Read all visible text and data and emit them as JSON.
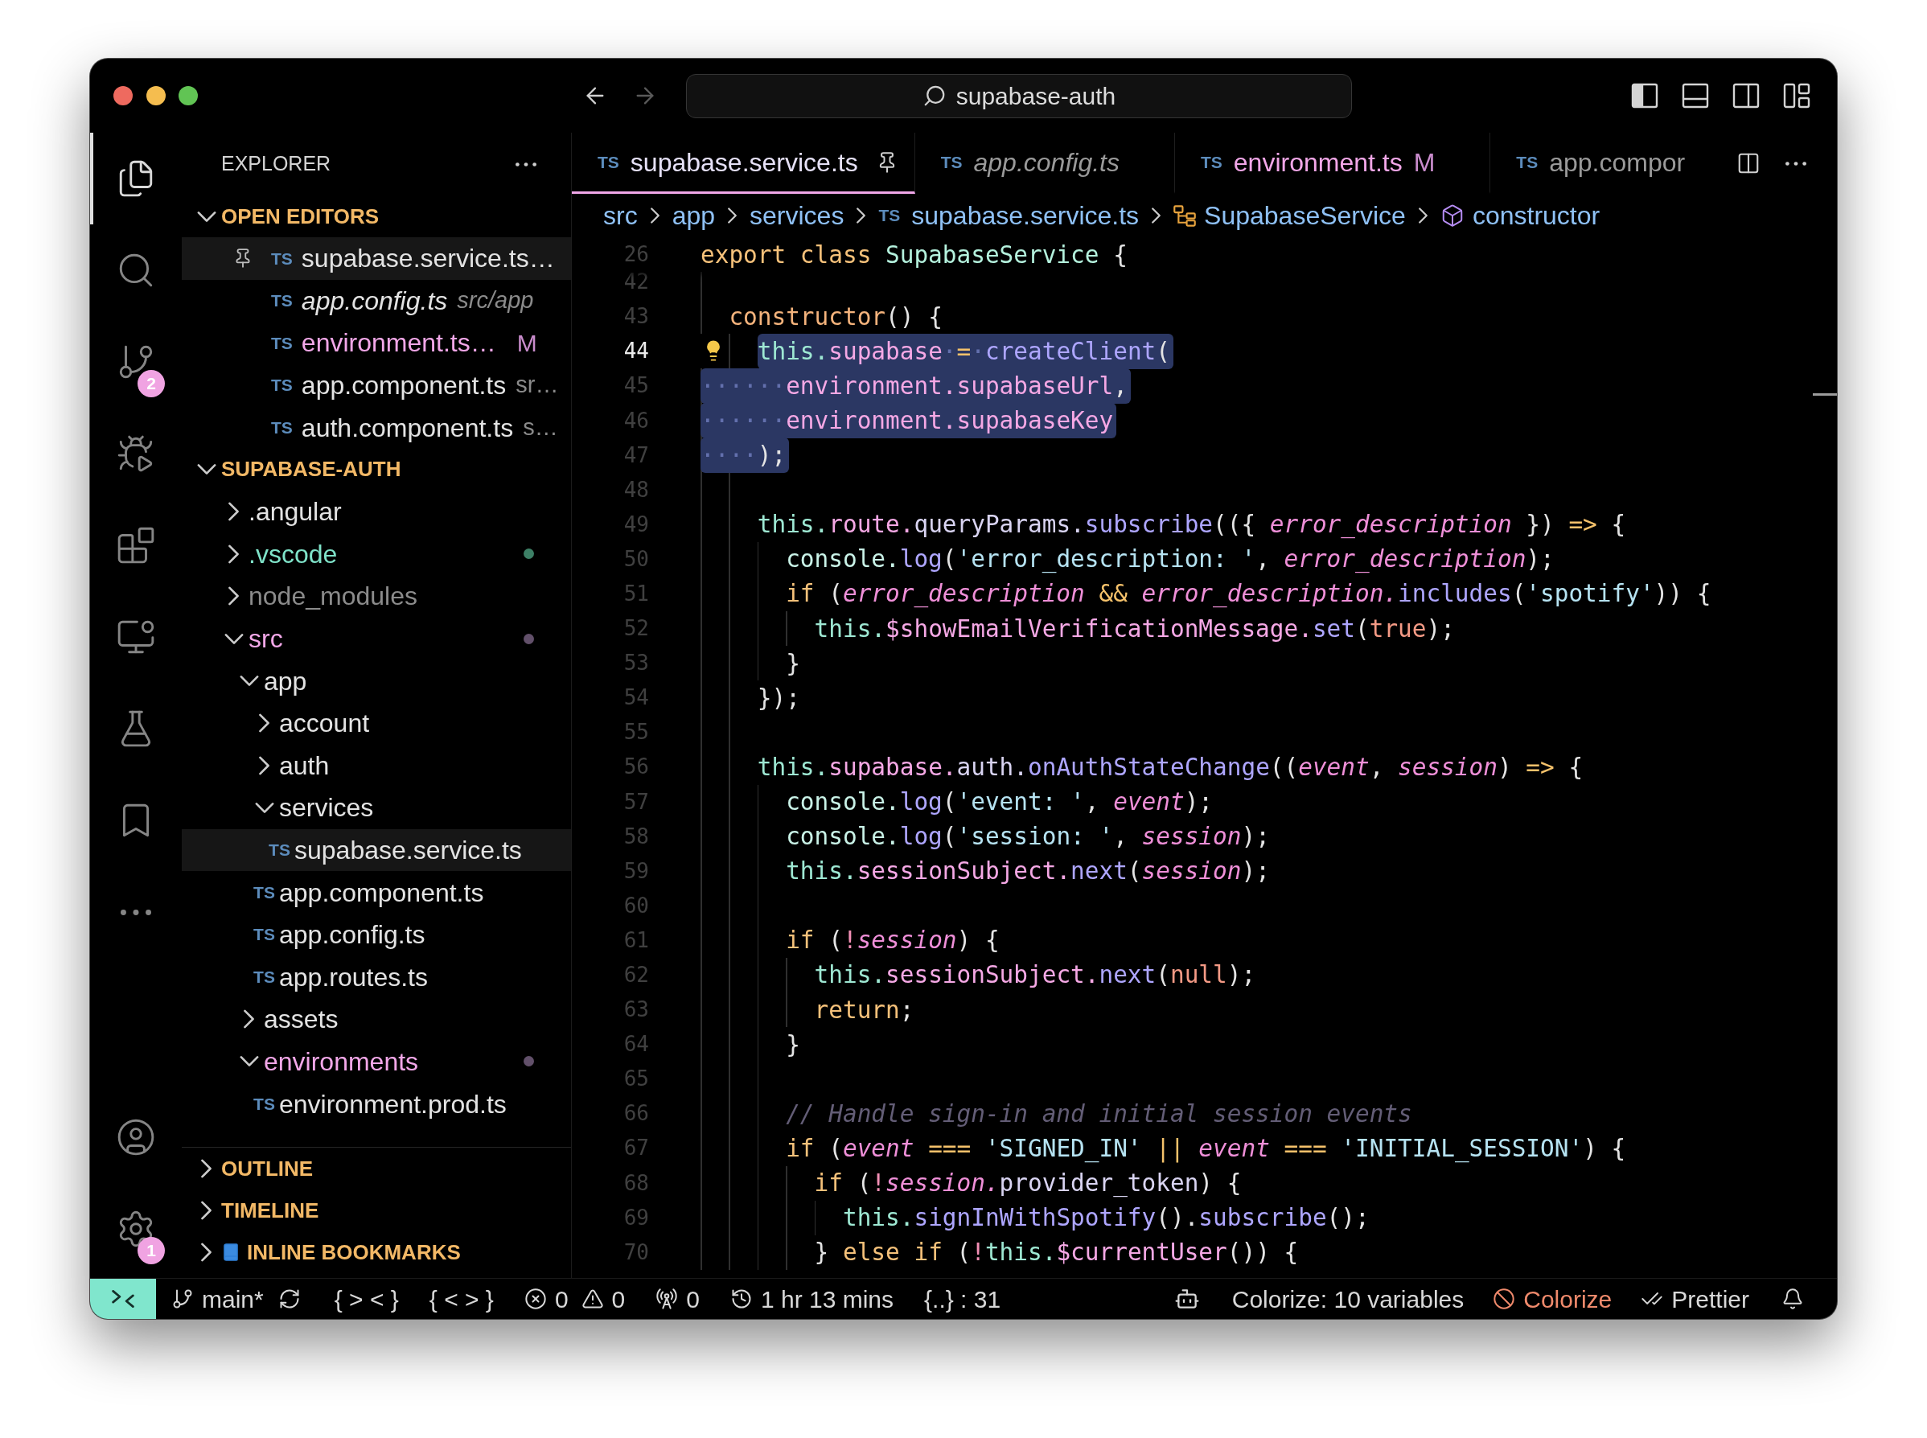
{
  "title_bar": {
    "navigation": [
      {
        "kind": "back",
        "disabled": false
      },
      {
        "kind": "forward",
        "disabled": true
      }
    ],
    "search_text": "supabase-auth",
    "layout_buttons": [
      {
        "kind": "primary-sidebar",
        "on": true
      },
      {
        "kind": "panel",
        "on": false
      },
      {
        "kind": "secondary-sidebar",
        "on": false
      },
      {
        "kind": "customize-layout"
      }
    ]
  },
  "activity_bar": {
    "top": [
      {
        "kind": "explorer",
        "selected": true
      },
      {
        "kind": "search",
        "selected": false
      },
      {
        "kind": "source-control",
        "selected": false,
        "badge": "2"
      },
      {
        "kind": "run-debug",
        "selected": false
      },
      {
        "kind": "extensions",
        "selected": false
      },
      {
        "kind": "remote-explorer",
        "selected": false
      },
      {
        "kind": "testing",
        "selected": false
      },
      {
        "kind": "bookmarks",
        "selected": false
      },
      {
        "kind": "more",
        "selected": false
      }
    ],
    "bottom": [
      {
        "kind": "accounts"
      },
      {
        "kind": "manage",
        "badge": "1"
      }
    ]
  },
  "sidebar": {
    "title": "EXPLORER",
    "open_editors": {
      "title": "OPEN EDITORS",
      "expanded": true,
      "items": [
        {
          "type_label": "TS",
          "name": "supabase.service.ts…",
          "pinned": true,
          "selected": true
        },
        {
          "type_label": "TS",
          "name": "app.config.ts",
          "description": "src/app",
          "preview": true,
          "selected": false
        },
        {
          "type_label": "TS",
          "name": "environment.ts…",
          "badge": "M",
          "modified": true,
          "selected": false
        },
        {
          "type_label": "TS",
          "name": "app.component.ts",
          "description": "sr…",
          "selected": false
        },
        {
          "type_label": "TS",
          "name": "auth.component.ts",
          "description": "s…",
          "selected": false
        }
      ]
    },
    "workspace": {
      "title": "SUPABASE-AUTH",
      "expanded": true,
      "tree": [
        {
          "kind": "folder",
          "name": ".angular",
          "expanded": false,
          "selected": false
        },
        {
          "kind": "folder",
          "name": ".vscode",
          "expanded": false,
          "selected": false,
          "untracked": true,
          "color": "#3d8066"
        },
        {
          "kind": "folder",
          "name": "node_modules",
          "expanded": false,
          "selected": false,
          "ignored": true
        },
        {
          "kind": "folder",
          "name": "src",
          "expanded": true,
          "selected": false,
          "modified": true,
          "color": "#62506a",
          "children": [
            {
              "kind": "folder",
              "name": "app",
              "expanded": true,
              "selected": false,
              "children": [
                {
                  "kind": "folder",
                  "name": "account",
                  "expanded": false,
                  "selected": false
                },
                {
                  "kind": "folder",
                  "name": "auth",
                  "expanded": false,
                  "selected": false
                },
                {
                  "kind": "folder",
                  "name": "services",
                  "expanded": true,
                  "selected": false,
                  "children": [
                    {
                      "kind": "file",
                      "type_label": "TS",
                      "name": "supabase.service.ts",
                      "selected": true
                    }
                  ]
                },
                {
                  "kind": "file",
                  "type_label": "TS",
                  "name": "app.component.ts",
                  "selected": false
                },
                {
                  "kind": "file",
                  "type_label": "TS",
                  "name": "app.config.ts",
                  "selected": false
                },
                {
                  "kind": "file",
                  "type_label": "TS",
                  "name": "app.routes.ts",
                  "selected": false
                }
              ]
            },
            {
              "kind": "folder",
              "name": "assets",
              "expanded": false,
              "selected": false
            },
            {
              "kind": "folder",
              "name": "environments",
              "expanded": true,
              "selected": false,
              "modified": true,
              "color": "#62506a",
              "children": [
                {
                  "kind": "file",
                  "type_label": "TS",
                  "name": "environment.prod.ts",
                  "selected": false
                }
              ]
            }
          ]
        }
      ]
    },
    "sections": [
      {
        "kind": "outline",
        "title": "OUTLINE",
        "expanded": false
      },
      {
        "kind": "timeline",
        "title": "TIMELINE",
        "expanded": false
      },
      {
        "kind": "bookmarks",
        "title": "INLINE BOOKMARKS",
        "expanded": false
      }
    ]
  },
  "editor": {
    "tabs": [
      {
        "type_label": "TS",
        "name": "supabase.service.ts",
        "selected": true,
        "pinned": true
      },
      {
        "type_label": "TS",
        "name": "app.config.ts",
        "selected": false,
        "preview": true
      },
      {
        "type_label": "TS",
        "name": "environment.ts",
        "badge": "M",
        "modified": true,
        "selected": false
      },
      {
        "type_label": "TS",
        "name": "app.compor",
        "selected": false
      }
    ],
    "breadcrumbs": [
      {
        "kind": "folder",
        "label": "src"
      },
      {
        "kind": "folder",
        "label": "app"
      },
      {
        "kind": "folder",
        "label": "services"
      },
      {
        "kind": "file",
        "type_label": "TS",
        "label": "supabase.service.ts"
      },
      {
        "kind": "class",
        "label": "SupabaseService"
      },
      {
        "kind": "method",
        "label": "constructor"
      }
    ],
    "sticky_line": {
      "number": "26",
      "current": false,
      "tokens": [
        {
          "text": "export class ",
          "kind": "keyword"
        },
        {
          "text": "SupabaseService",
          "kind": "class"
        },
        {
          "text": " {",
          "kind": "punct"
        }
      ]
    },
    "lines": [
      {
        "number": "42",
        "current": false
      },
      {
        "number": "43",
        "current": false,
        "tokens": [
          {
            "text": "  constructor",
            "kind": "definition"
          },
          {
            "text": "() {",
            "kind": "punct"
          }
        ]
      },
      {
        "number": "44",
        "current": true,
        "lightbulb": true,
        "in_selection": true,
        "tokens": [
          {
            "text": "    this.",
            "kind": "this"
          },
          {
            "text": "supabase",
            "kind": "prop"
          },
          {
            "text": "·",
            "kind": "whitespace"
          },
          {
            "text": "=",
            "kind": "op"
          },
          {
            "text": "·",
            "kind": "whitespace"
          },
          {
            "text": "createClient",
            "kind": "method"
          },
          {
            "text": "(",
            "kind": "punct"
          }
        ]
      },
      {
        "number": "45",
        "current": false,
        "in_selection": true,
        "tokens": [
          {
            "text": "······",
            "kind": "whitespace"
          },
          {
            "text": "environment.",
            "kind": "variable"
          },
          {
            "text": "supabaseUrl",
            "kind": "prop"
          },
          {
            "text": ",",
            "kind": "punct"
          }
        ]
      },
      {
        "number": "46",
        "current": false,
        "in_selection": true,
        "tokens": [
          {
            "text": "······",
            "kind": "whitespace"
          },
          {
            "text": "environment.",
            "kind": "variable"
          },
          {
            "text": "supabaseKey",
            "kind": "prop"
          }
        ]
      },
      {
        "number": "47",
        "current": false,
        "in_selection": true,
        "tokens": [
          {
            "text": "····",
            "kind": "whitespace"
          },
          {
            "text": ");",
            "kind": "punct"
          }
        ]
      },
      {
        "number": "48",
        "current": false
      },
      {
        "number": "49",
        "current": false,
        "tokens": [
          {
            "text": "    this.",
            "kind": "this"
          },
          {
            "text": "route.",
            "kind": "prop"
          },
          {
            "text": "queryParams.",
            "kind": "member"
          },
          {
            "text": "subscribe",
            "kind": "method"
          },
          {
            "text": "(({ ",
            "kind": "punct"
          },
          {
            "text": "error_description",
            "kind": "param"
          },
          {
            "text": " }) ",
            "kind": "punct"
          },
          {
            "text": "=>",
            "kind": "op"
          },
          {
            "text": " {",
            "kind": "punct"
          }
        ]
      },
      {
        "number": "50",
        "current": false,
        "tokens": [
          {
            "text": "      console.",
            "kind": "object"
          },
          {
            "text": "log",
            "kind": "method"
          },
          {
            "text": "(",
            "kind": "punct"
          },
          {
            "text": "'error_description: '",
            "kind": "string"
          },
          {
            "text": ", ",
            "kind": "punct"
          },
          {
            "text": "error_description",
            "kind": "param"
          },
          {
            "text": ");",
            "kind": "punct"
          }
        ]
      },
      {
        "number": "51",
        "current": false,
        "tokens": [
          {
            "text": "      if",
            "kind": "keyword"
          },
          {
            "text": " (",
            "kind": "punct"
          },
          {
            "text": "error_description",
            "kind": "param"
          },
          {
            "text": " && ",
            "kind": "op"
          },
          {
            "text": "error_description.",
            "kind": "param"
          },
          {
            "text": "includes",
            "kind": "method"
          },
          {
            "text": "(",
            "kind": "punct"
          },
          {
            "text": "'spotify'",
            "kind": "string"
          },
          {
            "text": ")) {",
            "kind": "punct"
          }
        ]
      },
      {
        "number": "52",
        "current": false,
        "tokens": [
          {
            "text": "        this.",
            "kind": "this"
          },
          {
            "text": "$showEmailVerificationMessage.",
            "kind": "prop"
          },
          {
            "text": "set",
            "kind": "method"
          },
          {
            "text": "(",
            "kind": "punct"
          },
          {
            "text": "true",
            "kind": "literal"
          },
          {
            "text": ");",
            "kind": "punct"
          }
        ]
      },
      {
        "number": "53",
        "current": false,
        "tokens": [
          {
            "text": "      }",
            "kind": "punct"
          }
        ]
      },
      {
        "number": "54",
        "current": false,
        "tokens": [
          {
            "text": "    });",
            "kind": "punct"
          }
        ]
      },
      {
        "number": "55",
        "current": false
      },
      {
        "number": "56",
        "current": false,
        "tokens": [
          {
            "text": "    this.",
            "kind": "this"
          },
          {
            "text": "supabase.",
            "kind": "prop"
          },
          {
            "text": "auth.",
            "kind": "member"
          },
          {
            "text": "onAuthStateChange",
            "kind": "method"
          },
          {
            "text": "((",
            "kind": "punct"
          },
          {
            "text": "event",
            "kind": "param"
          },
          {
            "text": ", ",
            "kind": "punct"
          },
          {
            "text": "session",
            "kind": "param"
          },
          {
            "text": ") ",
            "kind": "punct"
          },
          {
            "text": "=>",
            "kind": "op"
          },
          {
            "text": " {",
            "kind": "punct"
          }
        ]
      },
      {
        "number": "57",
        "current": false,
        "tokens": [
          {
            "text": "      console.",
            "kind": "object"
          },
          {
            "text": "log",
            "kind": "method"
          },
          {
            "text": "(",
            "kind": "punct"
          },
          {
            "text": "'event: '",
            "kind": "string"
          },
          {
            "text": ", ",
            "kind": "punct"
          },
          {
            "text": "event",
            "kind": "param"
          },
          {
            "text": ");",
            "kind": "punct"
          }
        ]
      },
      {
        "number": "58",
        "current": false,
        "tokens": [
          {
            "text": "      console.",
            "kind": "object"
          },
          {
            "text": "log",
            "kind": "method"
          },
          {
            "text": "(",
            "kind": "punct"
          },
          {
            "text": "'session: '",
            "kind": "string"
          },
          {
            "text": ", ",
            "kind": "punct"
          },
          {
            "text": "session",
            "kind": "param"
          },
          {
            "text": ");",
            "kind": "punct"
          }
        ]
      },
      {
        "number": "59",
        "current": false,
        "tokens": [
          {
            "text": "      this.",
            "kind": "this"
          },
          {
            "text": "sessionSubject.",
            "kind": "prop"
          },
          {
            "text": "next",
            "kind": "method"
          },
          {
            "text": "(",
            "kind": "punct"
          },
          {
            "text": "session",
            "kind": "param"
          },
          {
            "text": ");",
            "kind": "punct"
          }
        ]
      },
      {
        "number": "60",
        "current": false
      },
      {
        "number": "61",
        "current": false,
        "tokens": [
          {
            "text": "      if",
            "kind": "keyword"
          },
          {
            "text": " (",
            "kind": "punct"
          },
          {
            "text": "!",
            "kind": "not"
          },
          {
            "text": "session",
            "kind": "param"
          },
          {
            "text": ") {",
            "kind": "punct"
          }
        ]
      },
      {
        "number": "62",
        "current": false,
        "tokens": [
          {
            "text": "        this.",
            "kind": "this"
          },
          {
            "text": "sessionSubject.",
            "kind": "prop"
          },
          {
            "text": "next",
            "kind": "method"
          },
          {
            "text": "(",
            "kind": "punct"
          },
          {
            "text": "null",
            "kind": "literal"
          },
          {
            "text": ");",
            "kind": "punct"
          }
        ]
      },
      {
        "number": "63",
        "current": false,
        "tokens": [
          {
            "text": "        return",
            "kind": "keyword"
          },
          {
            "text": ";",
            "kind": "punct"
          }
        ]
      },
      {
        "number": "64",
        "current": false,
        "tokens": [
          {
            "text": "      }",
            "kind": "punct"
          }
        ]
      },
      {
        "number": "65",
        "current": false
      },
      {
        "number": "66",
        "current": false,
        "tokens": [
          {
            "text": "      // Handle sign-in and initial session events",
            "kind": "comment"
          }
        ]
      },
      {
        "number": "67",
        "current": false,
        "tokens": [
          {
            "text": "      if",
            "kind": "keyword"
          },
          {
            "text": " (",
            "kind": "punct"
          },
          {
            "text": "event",
            "kind": "param"
          },
          {
            "text": " === ",
            "kind": "op"
          },
          {
            "text": "'SIGNED_IN'",
            "kind": "string"
          },
          {
            "text": " || ",
            "kind": "op"
          },
          {
            "text": "event",
            "kind": "param"
          },
          {
            "text": " === ",
            "kind": "op"
          },
          {
            "text": "'INITIAL_SESSION'",
            "kind": "string"
          },
          {
            "text": ") {",
            "kind": "punct"
          }
        ]
      },
      {
        "number": "68",
        "current": false,
        "tokens": [
          {
            "text": "        if",
            "kind": "keyword"
          },
          {
            "text": " (",
            "kind": "punct"
          },
          {
            "text": "!",
            "kind": "not"
          },
          {
            "text": "session.",
            "kind": "param"
          },
          {
            "text": "provider_token",
            "kind": "member"
          },
          {
            "text": ") {",
            "kind": "punct"
          }
        ]
      },
      {
        "number": "69",
        "current": false,
        "tokens": [
          {
            "text": "          this.",
            "kind": "this"
          },
          {
            "text": "signInWithSpotify",
            "kind": "method"
          },
          {
            "text": "().",
            "kind": "punct"
          },
          {
            "text": "subscribe",
            "kind": "method"
          },
          {
            "text": "();",
            "kind": "punct"
          }
        ]
      },
      {
        "number": "70",
        "current": false,
        "tokens": [
          {
            "text": "        }",
            "kind": "punct"
          },
          {
            "text": " else if",
            "kind": "keyword"
          },
          {
            "text": " (",
            "kind": "punct"
          },
          {
            "text": "!",
            "kind": "not"
          },
          {
            "text": "this.",
            "kind": "this"
          },
          {
            "text": "$currentUser",
            "kind": "prop"
          },
          {
            "text": "()) {",
            "kind": "punct"
          }
        ]
      }
    ]
  },
  "status_bar": {
    "left": [
      {
        "kind": "remote"
      },
      {
        "kind": "branch",
        "text": "main*"
      },
      {
        "kind": "sync"
      },
      {
        "kind": "text",
        "text": "{ > < }"
      },
      {
        "kind": "text",
        "text": "{ < > }"
      },
      {
        "kind": "problems",
        "errors": "0",
        "warnings": "0"
      },
      {
        "kind": "ports",
        "text": "0"
      },
      {
        "kind": "timer",
        "text": "1 hr 13 mins"
      },
      {
        "kind": "text",
        "text": "{..} : 31"
      }
    ],
    "right": [
      {
        "kind": "assistant"
      },
      {
        "kind": "text",
        "text": "Colorize: 10 variables"
      },
      {
        "kind": "colorize",
        "text": "Colorize"
      },
      {
        "kind": "prettier",
        "text": "Prettier"
      },
      {
        "kind": "notifications"
      }
    ]
  }
}
